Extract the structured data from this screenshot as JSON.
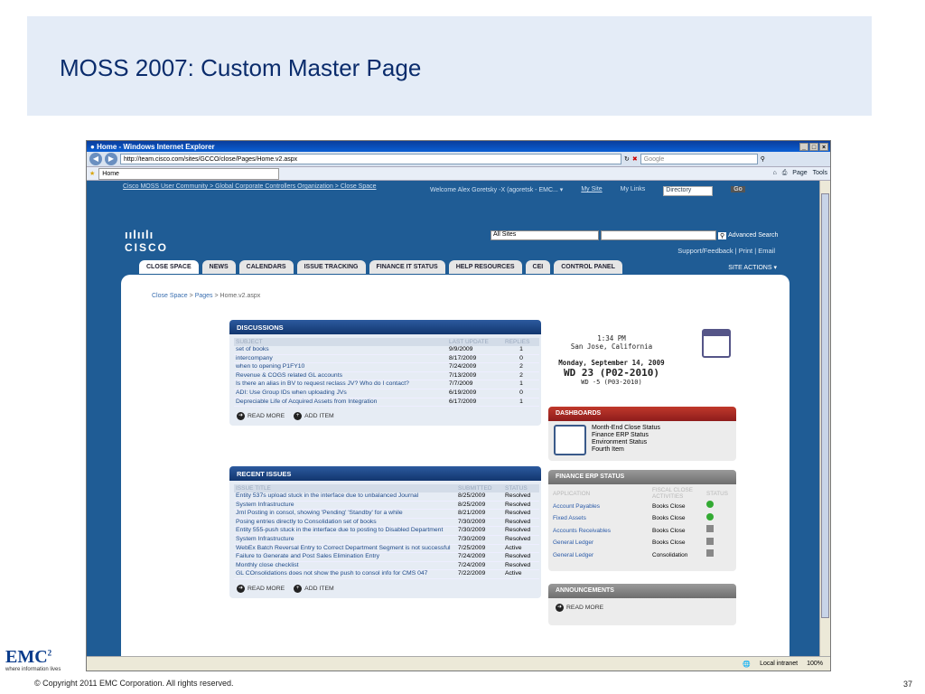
{
  "slide": {
    "title": "MOSS 2007: Custom Master Page",
    "copyright": "© Copyright 2011 EMC Corporation. All rights reserved.",
    "page_number": "37",
    "logo_text": "EMC",
    "logo_superscript": "2",
    "logo_tagline": "where information lives"
  },
  "browser": {
    "window_title": "Home - Windows Internet Explorer",
    "url": "http://team.cisco.com/sites/GCCO/close/Pages/Home.v2.aspx",
    "search_placeholder": "Google",
    "tab_label": "Home",
    "tools": [
      "Page",
      "Tools"
    ],
    "zone": "Local intranet",
    "zoom": "100%"
  },
  "site": {
    "breadcrumb_top": "Cisco MOSS User Community > Global Corporate Controllers Organization > Close Space",
    "welcome": "Welcome Alex Goretsky -X (agoretsk - EMC... ▾",
    "my_site": "My Site",
    "my_links": "My Links",
    "directory": "Directory",
    "go": "Go",
    "logo_word": "CISCO",
    "scope": "All Sites",
    "advanced_search": "Advanced Search",
    "support_line": "Support/Feedback | Print | Email",
    "tabs": [
      "CLOSE SPACE",
      "NEWS",
      "CALENDARS",
      "ISSUE TRACKING",
      "FINANCE IT STATUS",
      "HELP RESOURCES",
      "CEI",
      "CONTROL PANEL"
    ],
    "site_actions": "SITE ACTIONS ▾",
    "page_crumb": {
      "a": "Close Space",
      "b": "Pages",
      "c": "Home.v2.aspx"
    }
  },
  "discussions": {
    "title": "DISCUSSIONS",
    "headers": [
      "SUBJECT",
      "LAST UPDATE",
      "REPLIES"
    ],
    "rows": [
      [
        "set of books",
        "9/9/2009",
        "1"
      ],
      [
        "intercompany",
        "8/17/2009",
        "0"
      ],
      [
        "when to opening P1FY10",
        "7/24/2009",
        "2"
      ],
      [
        "Revenue & COGS related GL accounts",
        "7/13/2009",
        "2"
      ],
      [
        "Is there an alias in BV to request reclass JV? Who do I contact?",
        "7/7/2009",
        "1"
      ],
      [
        "ADI: Use Group IDs when uploading JVs",
        "6/19/2009",
        "0"
      ],
      [
        "Depreciable Life of Acquired Assets from Integration",
        "6/17/2009",
        "1"
      ]
    ],
    "read_more": "READ MORE",
    "add_item": "ADD ITEM"
  },
  "issues": {
    "title": "RECENT ISSUES",
    "headers": [
      "ISSUE TITLE",
      "SUBMITTED",
      "STATUS"
    ],
    "rows": [
      [
        "Entity 537s upload stuck in the interface due to unbalanced Journal",
        "8/25/2009",
        "Resolved"
      ],
      [
        "System Infrastructure",
        "8/25/2009",
        "Resolved"
      ],
      [
        "Jrnl Posting in consol, showing 'Pending' 'Standby' for a while",
        "8/21/2009",
        "Resolved"
      ],
      [
        "Posing entries directly to Consolidation set of books",
        "7/30/2009",
        "Resolved"
      ],
      [
        "Entity 555-push stuck in the interface due to posting to Disabled Department",
        "7/30/2009",
        "Resolved"
      ],
      [
        "System Infrastructure",
        "7/30/2009",
        "Resolved"
      ],
      [
        "WebEx Batch Reversal Entry to Correct Department Segment is not successful",
        "7/25/2009",
        "Active"
      ],
      [
        "Failure to Generate and Post Sales Elimination Entry",
        "7/24/2009",
        "Resolved"
      ],
      [
        "Monthly close checklist",
        "7/24/2009",
        "Resolved"
      ],
      [
        "GL COnsolidations does not show the push to consol info for CMS 047",
        "7/22/2009",
        "Active"
      ]
    ],
    "read_more": "READ MORE",
    "add_item": "ADD ITEM"
  },
  "clock": {
    "time": "1:34 PM",
    "location": "San Jose, California",
    "date": "Monday, September 14, 2009",
    "wd": "WD 23 (P02-2010)",
    "wd_sub": "WD -5 (P03-2010)"
  },
  "dashboards": {
    "title": "DASHBOARDS",
    "items": [
      "Month-End Close Status",
      "Finance ERP Status",
      "Environment Status",
      "Fourth Item"
    ]
  },
  "erp": {
    "title": "FINANCE ERP STATUS",
    "headers": [
      "APPLICATION",
      "FISCAL CLOSE ACTIVITIES",
      "STATUS"
    ],
    "rows": [
      [
        "Account Payables",
        "Books Close"
      ],
      [
        "Fixed Assets",
        "Books Close"
      ],
      [
        "Accounts Receivables",
        "Books Close"
      ],
      [
        "General Ledger",
        "Books Close"
      ],
      [
        "General Ledger",
        "Consolidation"
      ]
    ]
  },
  "announcements": {
    "title": "ANNOUNCEMENTS",
    "read_more": "READ MORE"
  },
  "colors": {
    "brand_blue": "#1f5c95",
    "dash_red": "#b02a2a",
    "erp_gray": "#8a8a8a"
  }
}
